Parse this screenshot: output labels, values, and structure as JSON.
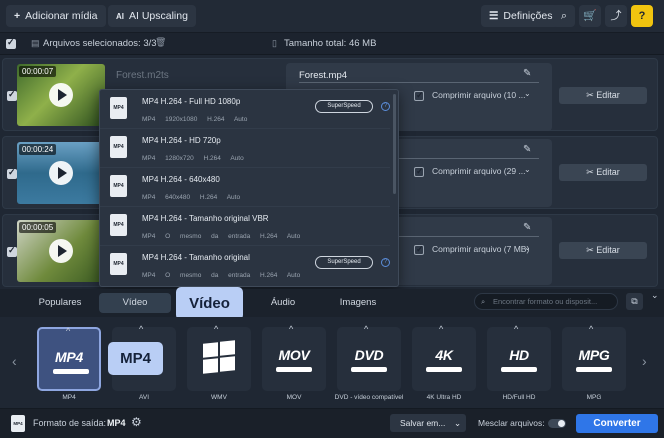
{
  "toolbar": {
    "add_media": "Adicionar mídia",
    "ai_upscaling": "AI Upscaling",
    "settings": "Definições"
  },
  "selection": {
    "selected_label": "Arquivos selecionados: 3/3",
    "total_size": "Tamanho total: 46 MB"
  },
  "files": [
    {
      "time": "00:00:07",
      "name": "Forest.m2ts",
      "output_name": "Forest.mp4",
      "compress": "Comprimir arquivo (10 ...",
      "edit": "Editar"
    },
    {
      "time": "00:00:24",
      "name": "",
      "output_name": "",
      "compress": "Comprimir arquivo (29 ...",
      "edit": "Editar"
    },
    {
      "time": "00:00:05",
      "name": "",
      "output_name": "",
      "compress": "Comprimir arquivo (7 MB)",
      "edit": "Editar"
    }
  ],
  "menu": {
    "items": [
      {
        "title": "MP4 H.264 - Full HD 1080p",
        "details": "MP4 1920x1080 H.264 Auto",
        "superspeed": "SuperSpeed"
      },
      {
        "title": "MP4 H.264 - HD 720p",
        "details": "MP4 1280x720 H.264 Auto",
        "superspeed": ""
      },
      {
        "title": "MP4 H.264 - 640x480",
        "details": "MP4 640x480 H.264 Auto",
        "superspeed": ""
      },
      {
        "title": "MP4 H.264 - Tamanho original VBR",
        "details": "MP4 O mesmo da entrada H.264 Auto",
        "superspeed": ""
      },
      {
        "title": "MP4 H.264 - Tamanho original",
        "details": "MP4 O mesmo da entrada H.264 Auto",
        "superspeed": "SuperSpeed"
      }
    ]
  },
  "tabs": {
    "popular": "Populares",
    "video": "Vídeo",
    "audio": "Áudio",
    "images": "Imagens",
    "tooltip": "Vídeo"
  },
  "search": {
    "placeholder": "Encontrar formato ou disposit..."
  },
  "formats": [
    {
      "logo": "MP4",
      "label": "MP4"
    },
    {
      "logo": "",
      "label": "AVI"
    },
    {
      "logo": "WMV",
      "label": "WMV"
    },
    {
      "logo": "MOV",
      "label": "MOV"
    },
    {
      "logo": "DVD",
      "label": "DVD - vídeo compatível"
    },
    {
      "logo": "4K",
      "label": "4K Ultra HD"
    },
    {
      "logo": "HD",
      "label": "HD/Full HD"
    },
    {
      "logo": "MPG",
      "label": "MPG"
    }
  ],
  "format_tooltip": "MP4",
  "bottom": {
    "output_label": "Formato de saída:",
    "output_value": "MP4",
    "save": "Salvar em...",
    "merge": "Mesclar arquivos:",
    "convert": "Converter"
  },
  "colors": {
    "accent": "#2f76e8",
    "help": "#f1c40f",
    "tooltip": "#b9cef5"
  }
}
